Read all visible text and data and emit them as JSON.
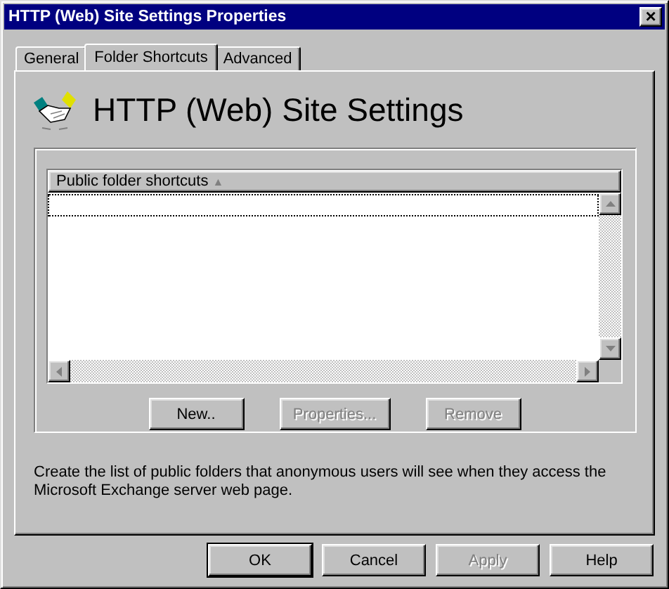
{
  "window": {
    "title": "HTTP (Web) Site Settings Properties",
    "close": "×"
  },
  "tabs": [
    {
      "label": "General",
      "selected": false
    },
    {
      "label": "Folder Shortcuts",
      "selected": true
    },
    {
      "label": "Advanced",
      "selected": false
    }
  ],
  "header": {
    "title": "HTTP (Web) Site Settings"
  },
  "list": {
    "column": "Public folder shortcuts",
    "sort": "▲"
  },
  "list_buttons": [
    {
      "label": "New..",
      "disabled": false
    },
    {
      "label": "Properties...",
      "disabled": true
    },
    {
      "label": "Remove",
      "disabled": true
    }
  ],
  "description": "Create the list of public folders that anonymous users will see when they access the Microsoft Exchange server web page.",
  "buttons": [
    {
      "label": "OK",
      "disabled": false,
      "default": true
    },
    {
      "label": "Cancel",
      "disabled": false,
      "default": false
    },
    {
      "label": "Apply",
      "disabled": true,
      "default": false
    },
    {
      "label": "Help",
      "disabled": false,
      "default": false
    }
  ]
}
